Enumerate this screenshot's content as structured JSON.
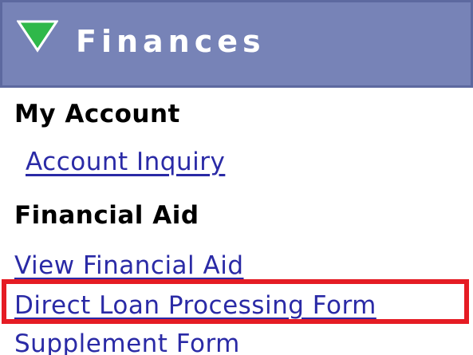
{
  "header": {
    "title": "Finances",
    "toggle_icon": "triangle-down-icon",
    "background_color": "#7783b7",
    "toggle_color": "#2fb84a"
  },
  "my_account": {
    "heading": "My Account",
    "links": [
      {
        "label": "Account Inquiry"
      }
    ]
  },
  "financial_aid": {
    "heading": "Financial Aid",
    "links": [
      {
        "label": "View Financial Aid"
      },
      {
        "label": "Direct Loan Processing Form"
      },
      {
        "label": "Supplement Form"
      }
    ]
  },
  "highlight": {
    "color": "#e51c24",
    "target": "Direct Loan Processing Form"
  },
  "link_color": "#2a2aa6"
}
